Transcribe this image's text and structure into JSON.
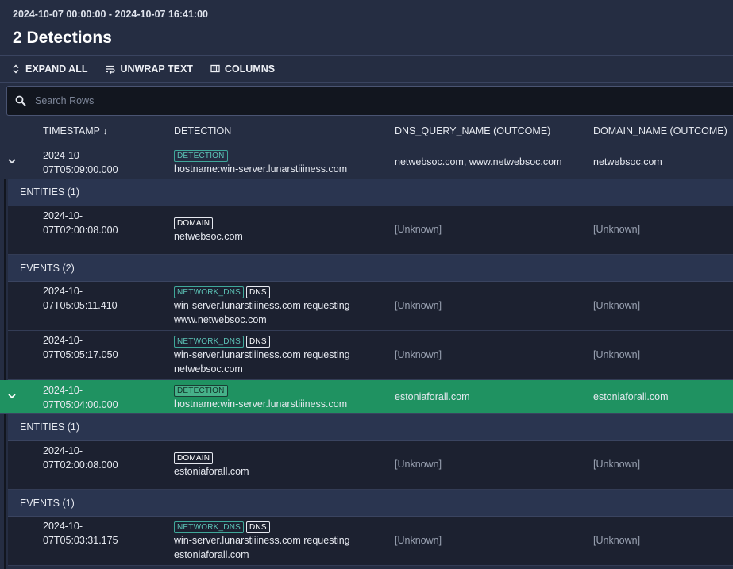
{
  "header": {
    "time_range": "2024-10-07 00:00:00 - 2024-10-07 16:41:00",
    "title": "2 Detections"
  },
  "toolbar": {
    "expand_all": "EXPAND ALL",
    "unwrap_text": "UNWRAP TEXT",
    "columns": "COLUMNS"
  },
  "search": {
    "placeholder": "Search Rows"
  },
  "columns": {
    "timestamp": "TIMESTAMP ↓",
    "detection": "DETECTION",
    "dns_query_name": "DNS_QUERY_NAME (OUTCOME)",
    "domain_name": "DOMAIN_NAME (OUTCOME)"
  },
  "detections": [
    {
      "ts1": "2024-10-",
      "ts2": "07T05:09:00.000",
      "tag": "DETECTION",
      "text": "hostname:win-server.lunarstiiiness.com",
      "dns": "netwebsoc.com, www.netwebsoc.com",
      "domain": "netwebsoc.com",
      "entities_label": "ENTITIES (1)",
      "entities": [
        {
          "ts1": "2024-10-",
          "ts2": "07T02:00:08.000",
          "tag": "DOMAIN",
          "text": "netwebsoc.com",
          "dns": "[Unknown]",
          "domain": "[Unknown]"
        }
      ],
      "events_label": "EVENTS (2)",
      "events": [
        {
          "ts1": "2024-10-",
          "ts2": "07T05:05:11.410",
          "tag1": "NETWORK_DNS",
          "tag2": "DNS",
          "text1": "win-server.lunarstiiiness.com requesting",
          "text2": "www.netwebsoc.com",
          "dns": "[Unknown]",
          "domain": "[Unknown]"
        },
        {
          "ts1": "2024-10-",
          "ts2": "07T05:05:17.050",
          "tag1": "NETWORK_DNS",
          "tag2": "DNS",
          "text1": "win-server.lunarstiiiness.com requesting",
          "text2": "netwebsoc.com",
          "dns": "[Unknown]",
          "domain": "[Unknown]"
        }
      ]
    },
    {
      "ts1": "2024-10-",
      "ts2": "07T05:04:00.000",
      "tag": "DETECTION",
      "text": "hostname:win-server.lunarstiiiness.com",
      "dns": "estoniaforall.com",
      "domain": "estoniaforall.com",
      "entities_label": "ENTITIES (1)",
      "entities": [
        {
          "ts1": "2024-10-",
          "ts2": "07T02:00:08.000",
          "tag": "DOMAIN",
          "text": "estoniaforall.com",
          "dns": "[Unknown]",
          "domain": "[Unknown]"
        }
      ],
      "events_label": "EVENTS (1)",
      "events": [
        {
          "ts1": "2024-10-",
          "ts2": "07T05:03:31.175",
          "tag1": "NETWORK_DNS",
          "tag2": "DNS",
          "text1": "win-server.lunarstiiiness.com requesting",
          "text2": "estoniaforall.com",
          "dns": "[Unknown]",
          "domain": "[Unknown]"
        }
      ]
    }
  ]
}
